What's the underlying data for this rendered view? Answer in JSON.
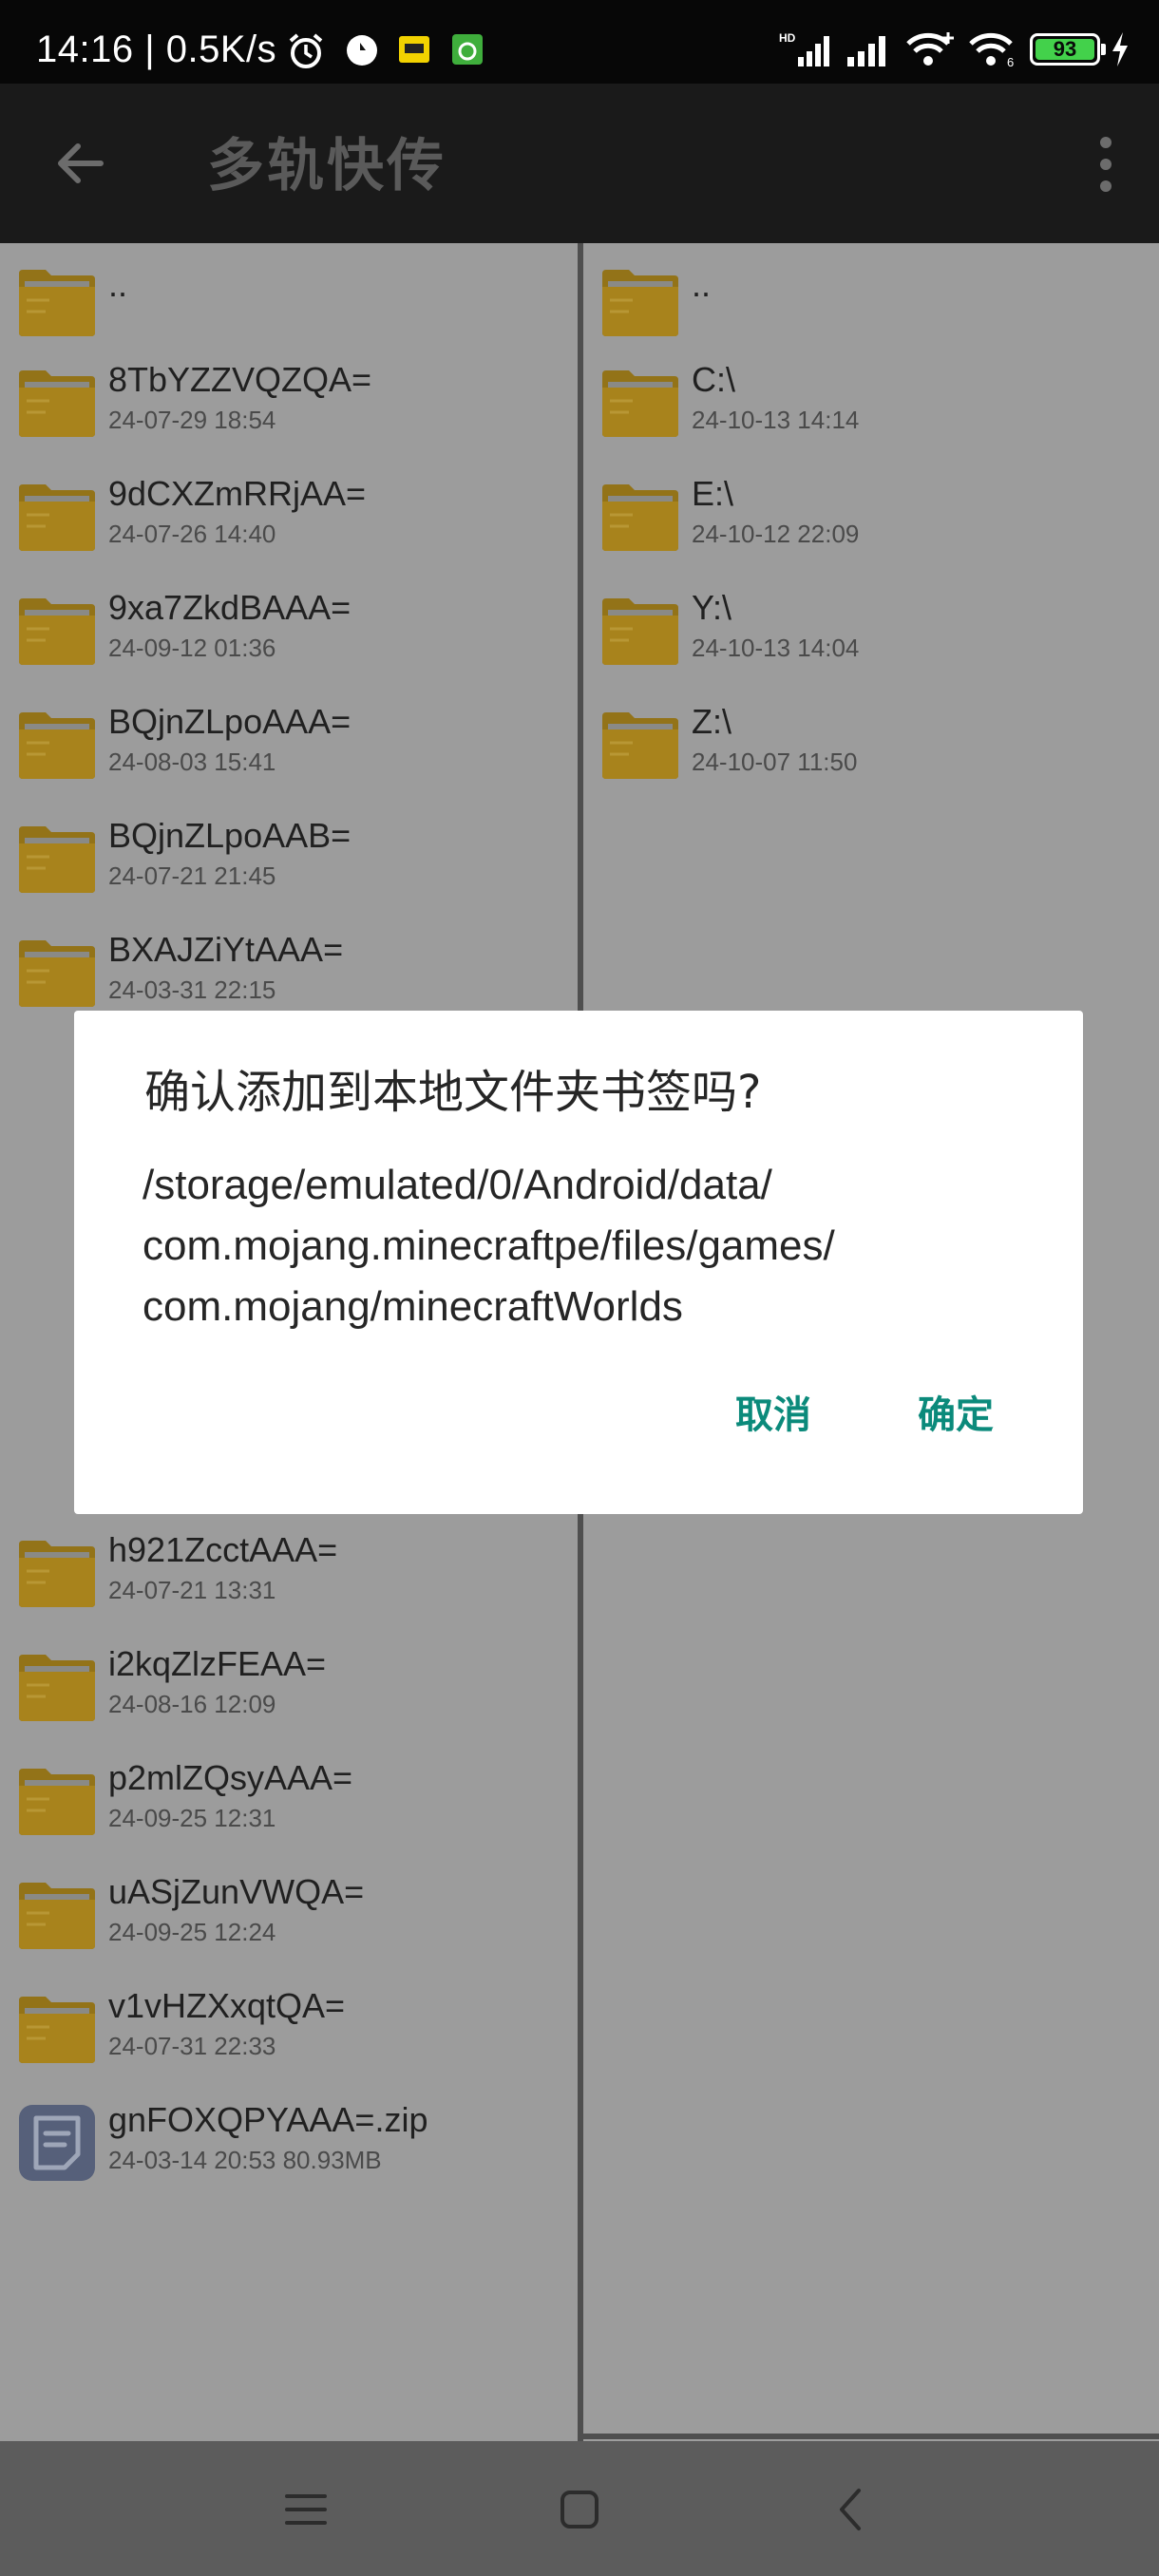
{
  "status_bar": {
    "time": "14:16 | 0.5K/s",
    "battery": "93",
    "icons": [
      "alarm-icon",
      "media-icon",
      "app-icon",
      "android-icon",
      "hd-signal-icon",
      "signal-icon",
      "wifi-plus-icon",
      "wifi-6-icon",
      "battery-icon",
      "charging-icon"
    ]
  },
  "app_bar": {
    "title": "多轨快传",
    "back_icon": "arrow-left-icon",
    "menu_icon": "more-vert-icon"
  },
  "left_pane": {
    "items": [
      {
        "name": "..",
        "meta": "",
        "icon": "folder-icon"
      },
      {
        "name": "8TbYZZVQZQA=",
        "meta": "24-07-29 18:54",
        "icon": "folder-icon"
      },
      {
        "name": "9dCXZmRRjAA=",
        "meta": "24-07-26 14:40",
        "icon": "folder-icon"
      },
      {
        "name": "9xa7ZkdBAAA=",
        "meta": "24-09-12 01:36",
        "icon": "folder-icon"
      },
      {
        "name": "BQjnZLpoAAA=",
        "meta": "24-08-03 15:41",
        "icon": "folder-icon"
      },
      {
        "name": "BQjnZLpoAAB=",
        "meta": "24-07-21 21:45",
        "icon": "folder-icon"
      },
      {
        "name": "BXAJZiYtAAA=",
        "meta": "24-03-31 22:15",
        "icon": "folder-icon"
      },
      {
        "name": "h921ZcctAAA=",
        "meta": "24-07-21 13:31",
        "icon": "folder-icon"
      },
      {
        "name": "i2kqZlzFEAA=",
        "meta": "24-08-16 12:09",
        "icon": "folder-icon"
      },
      {
        "name": "p2mlZQsyAAA=",
        "meta": "24-09-25 12:31",
        "icon": "folder-icon"
      },
      {
        "name": "uASjZunVWQA=",
        "meta": "24-09-25 12:24",
        "icon": "folder-icon"
      },
      {
        "name": "v1vHZXxqtQA=",
        "meta": "24-07-31 22:33",
        "icon": "folder-icon"
      },
      {
        "name": "gnFOXQPYAAA=.zip",
        "meta": "24-03-14 20:53 80.93MB",
        "icon": "file-icon"
      }
    ]
  },
  "right_pane": {
    "items": [
      {
        "name": "..",
        "meta": "",
        "icon": "folder-icon"
      },
      {
        "name": "C:\\",
        "meta": "24-10-13 14:14",
        "icon": "folder-icon"
      },
      {
        "name": "E:\\",
        "meta": "24-10-12 22:09",
        "icon": "folder-icon"
      },
      {
        "name": "Y:\\",
        "meta": "24-10-13 14:04",
        "icon": "folder-icon"
      },
      {
        "name": "Z:\\",
        "meta": "24-10-07 11:50",
        "icon": "folder-icon"
      }
    ]
  },
  "dialog": {
    "title": "确认添加到本地文件夹书签吗?",
    "message_lines": [
      "/storage/emulated/0/Android/data/",
      "com.mojang.minecraftpe/files/games/",
      "com.mojang/minecraftWorlds"
    ],
    "cancel_label": "取消",
    "confirm_label": "确定",
    "accent_color": "#0b8a7b"
  },
  "nav_bar": {
    "icons": [
      "menu-icon",
      "home-icon",
      "back-icon"
    ]
  }
}
